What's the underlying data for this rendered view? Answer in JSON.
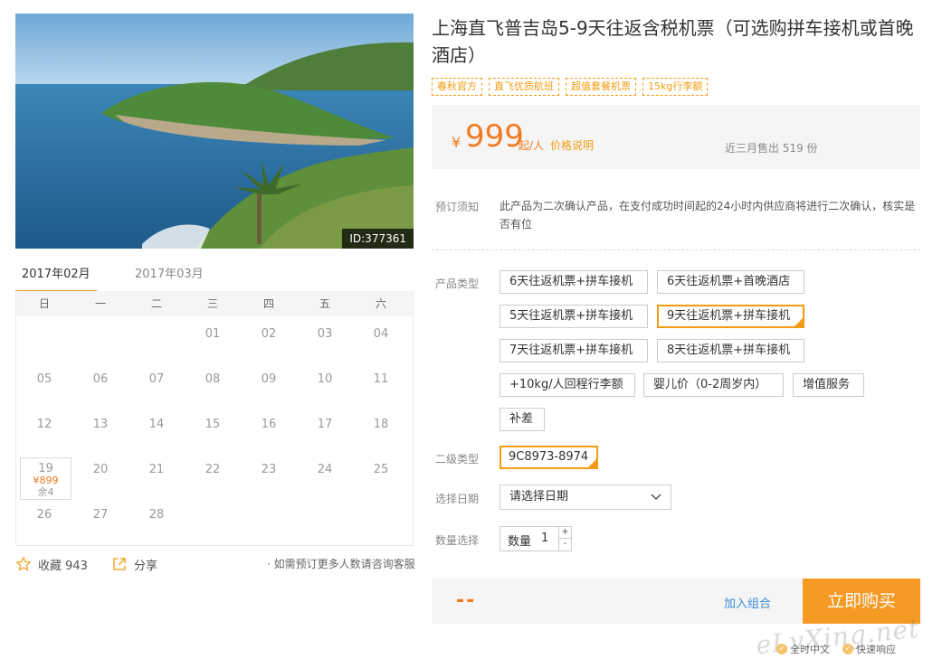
{
  "photo": {
    "id_badge": "ID:377361"
  },
  "calendar": {
    "tabs": [
      "2017年02月",
      "2017年03月"
    ],
    "weekdays": [
      "日",
      "一",
      "二",
      "三",
      "四",
      "五",
      "六"
    ],
    "days": [
      "01",
      "02",
      "03",
      "04",
      "05",
      "06",
      "07",
      "08",
      "09",
      "10",
      "11",
      "12",
      "13",
      "14",
      "15",
      "16",
      "17",
      "18",
      "19",
      "20",
      "21",
      "22",
      "23",
      "24",
      "25",
      "26",
      "27",
      "28"
    ],
    "selected_day": {
      "day": "19",
      "price": "¥899",
      "remain": "余4"
    }
  },
  "actions": {
    "favorite_label": "收藏 943",
    "share_label": "分享",
    "consult_note": "· 如需预订更多人数请咨询客服"
  },
  "product": {
    "title": "上海直飞普吉岛5-9天往返含税机票（可选购拼车接机或首晚酒店）",
    "tags": [
      "春秋官方",
      "直飞优质航班",
      "超值套餐机票",
      "15kg行李额"
    ],
    "price_symbol": "¥",
    "price": "999",
    "price_unit": "起/人",
    "price_explain": "价格说明",
    "sold": "近三月售出 519 份"
  },
  "notice": {
    "label": "预订须知",
    "text": "此产品为二次确认产品，在支付成功时间起的24小时内供应商将进行二次确认，核实是否有位"
  },
  "options": {
    "product_type_label": "产品类型",
    "product_types": [
      "6天往返机票+拼车接机",
      "6天往返机票+首晚酒店",
      "5天往返机票+拼车接机",
      "9天往返机票+拼车接机",
      "7天往返机票+拼车接机",
      "8天往返机票+拼车接机",
      "+10kg/人回程行李额",
      "婴儿价（0-2周岁内）",
      "增值服务",
      "补差"
    ],
    "selected_product_type": "9天往返机票+拼车接机",
    "sub_type_label": "二级类型",
    "sub_type": "9C8973-8974",
    "date_label": "选择日期",
    "date_placeholder": "请选择日期",
    "qty_label": "数量选择",
    "qty_inner_label": "数量",
    "qty_value": "1",
    "qty_inc": "+",
    "qty_dec": "-"
  },
  "bottom": {
    "total": "--",
    "combo_label": "加入组合",
    "buy_label": "立即购买"
  },
  "footer": {
    "badges": [
      "全时中文",
      "快速响应"
    ],
    "watermark": "eLvXing.net"
  },
  "colors": {
    "accent": "#f39c12",
    "price": "#f47a20",
    "buy": "#f59a23",
    "link": "#3a8bd6"
  }
}
